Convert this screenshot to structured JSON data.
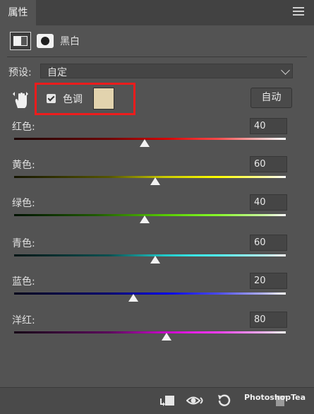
{
  "panel": {
    "tab_label": "属性",
    "title": "黑白"
  },
  "preset": {
    "label": "预设:",
    "value": "自定"
  },
  "tint": {
    "label": "色调",
    "checked": true,
    "color": "#e2d3ae",
    "highlight_color": "#ee1c1c"
  },
  "auto_button": "自动",
  "sliders": [
    {
      "label": "红色:",
      "value": "40",
      "gradient": "linear-gradient(to right,#1a0000,#6e0000 35%,#d00000 55%,#ff4a4a 75%,#ffc8c8 92%,#ffffff)"
    },
    {
      "label": "黄色:",
      "value": "60",
      "gradient": "linear-gradient(to right,#151500,#555500 35%,#c8c800 55%,#ffff00 75%,#ffffa0 92%,#ffffff)"
    },
    {
      "label": "绿色:",
      "value": "40",
      "gradient": "linear-gradient(to right,#001200,#1f5a00 30%,#55c800 55%,#88ff2a 75%,#ccffa0 92%,#ffffff)"
    },
    {
      "label": "青色:",
      "value": "60",
      "gradient": "linear-gradient(to right,#001515,#0c5050 35%,#20c8c8 55%,#50ffff 75%,#b4ffff 92%,#ffffff)"
    },
    {
      "label": "蓝色:",
      "value": "20",
      "gradient": "linear-gradient(to right,#00001a,#000070 35%,#0000e0 55%,#4a4aff 75%,#b4b4ff 92%,#ffffff)"
    },
    {
      "label": "洋红:",
      "value": "80",
      "gradient": "linear-gradient(to right,#150015,#5a005a 35%,#c800c8 55%,#ff3cff 75%,#ffb4ff 92%,#ffffff)"
    }
  ],
  "watermark": "PhotoshopTea",
  "icons": [
    "panel-menu-icon",
    "black-white-layer-icon",
    "mask-icon",
    "chevron-down-icon",
    "targeted-adjustment-hand-icon",
    "clip-to-layer-icon",
    "toggle-visibility-icon",
    "reset-icon",
    "delete-icon"
  ]
}
